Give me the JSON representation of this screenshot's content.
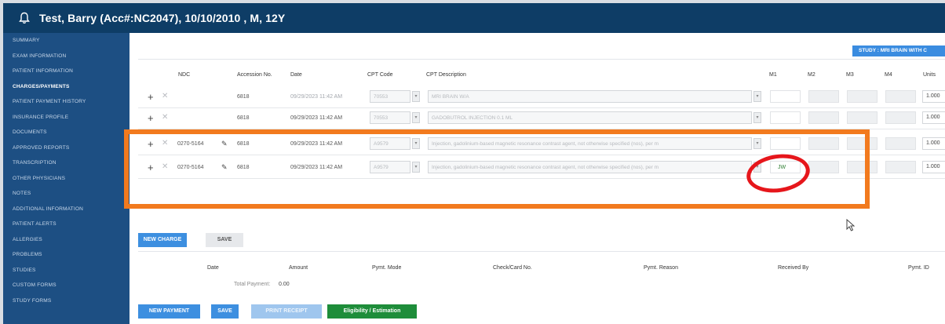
{
  "header": {
    "patient_name": "Test, Barry",
    "patient_info": "(Acc#:NC2047), 10/10/2010 , M, 12Y",
    "icon": "bell-icon"
  },
  "sidebar": {
    "items": [
      {
        "label": "Summary"
      },
      {
        "label": "Exam Information"
      },
      {
        "label": "Patient Information"
      },
      {
        "label": "Charges/Payments",
        "active": true
      },
      {
        "label": "Patient Payment History"
      },
      {
        "label": "Insurance Profile"
      },
      {
        "label": "Documents"
      },
      {
        "label": "Approved Reports"
      },
      {
        "label": "Transcription"
      },
      {
        "label": "Other Physicians"
      },
      {
        "label": "Notes"
      },
      {
        "label": "Additional Information"
      },
      {
        "label": "Patient Alerts"
      },
      {
        "label": "Allergies"
      },
      {
        "label": "Problems"
      },
      {
        "label": "Studies"
      },
      {
        "label": "Custom Forms"
      },
      {
        "label": "Study Forms"
      }
    ]
  },
  "study_badge": "STUDY : MRI BRAIN WITH C",
  "charges_table": {
    "headers": {
      "ndc": "NDC",
      "accession": "Accession No.",
      "date": "Date",
      "cpt_code": "CPT Code",
      "cpt_description": "CPT Description",
      "m1": "M1",
      "m2": "M2",
      "m3": "M3",
      "m4": "M4",
      "units": "Units"
    },
    "rows": [
      {
        "ndc": "",
        "accession": "6818",
        "date": "09/29/2023 11:42 AM",
        "cpt_code": "70553",
        "cpt_description": "MRI BRAIN W/A",
        "m1": "",
        "units": "1.000"
      },
      {
        "ndc": "",
        "accession": "6818",
        "date": "09/29/2023 11:42 AM",
        "cpt_code": "70553",
        "cpt_description": "GADOBUTROL INJECTION 0.1 ML",
        "m1": "",
        "units": "1.000"
      },
      {
        "ndc": "0270-5164",
        "accession": "6818",
        "date": "09/29/2023 11:42 AM",
        "cpt_code": "A9579",
        "cpt_description": "Injection, gadolinium-based magnetic resonance contrast agent, not otherwise specified (nos), per m",
        "m1": "",
        "units": "1.000"
      },
      {
        "ndc": "0270-5164",
        "accession": "6818",
        "date": "09/29/2023 11:42 AM",
        "cpt_code": "A9579",
        "cpt_description": "Injection, gadolinium-based magnetic resonance contrast agent, not otherwise specified (nos), per m",
        "m1": "JW",
        "units": "1.000"
      }
    ]
  },
  "buttons": {
    "new_charge": "NEW CHARGE",
    "save": "SAVE",
    "new_payment": "NEW PAYMENT",
    "save_payment": "SAVE",
    "print_receipt": "PRINT RECEIPT",
    "eligibility": "Eligibility / Estimation"
  },
  "payments_table": {
    "headers": {
      "date": "Date",
      "amount": "Amount",
      "mode": "Pymt. Mode",
      "check": "Check/Card No.",
      "reason": "Pymt. Reason",
      "received_by": "Received By",
      "pymt_id": "Pymt. ID"
    },
    "total_label": "Total Payment:",
    "total_value": "0.00"
  },
  "colors": {
    "header_bg": "#0e3d66",
    "sidebar_bg": "#1d4f83",
    "primary_button": "#3d8fe0",
    "eligibility_button": "#1e8d3a",
    "annotation_rect": "#f27a1e",
    "annotation_circle": "#e6161b",
    "modifier_text": "#2e7d32"
  }
}
